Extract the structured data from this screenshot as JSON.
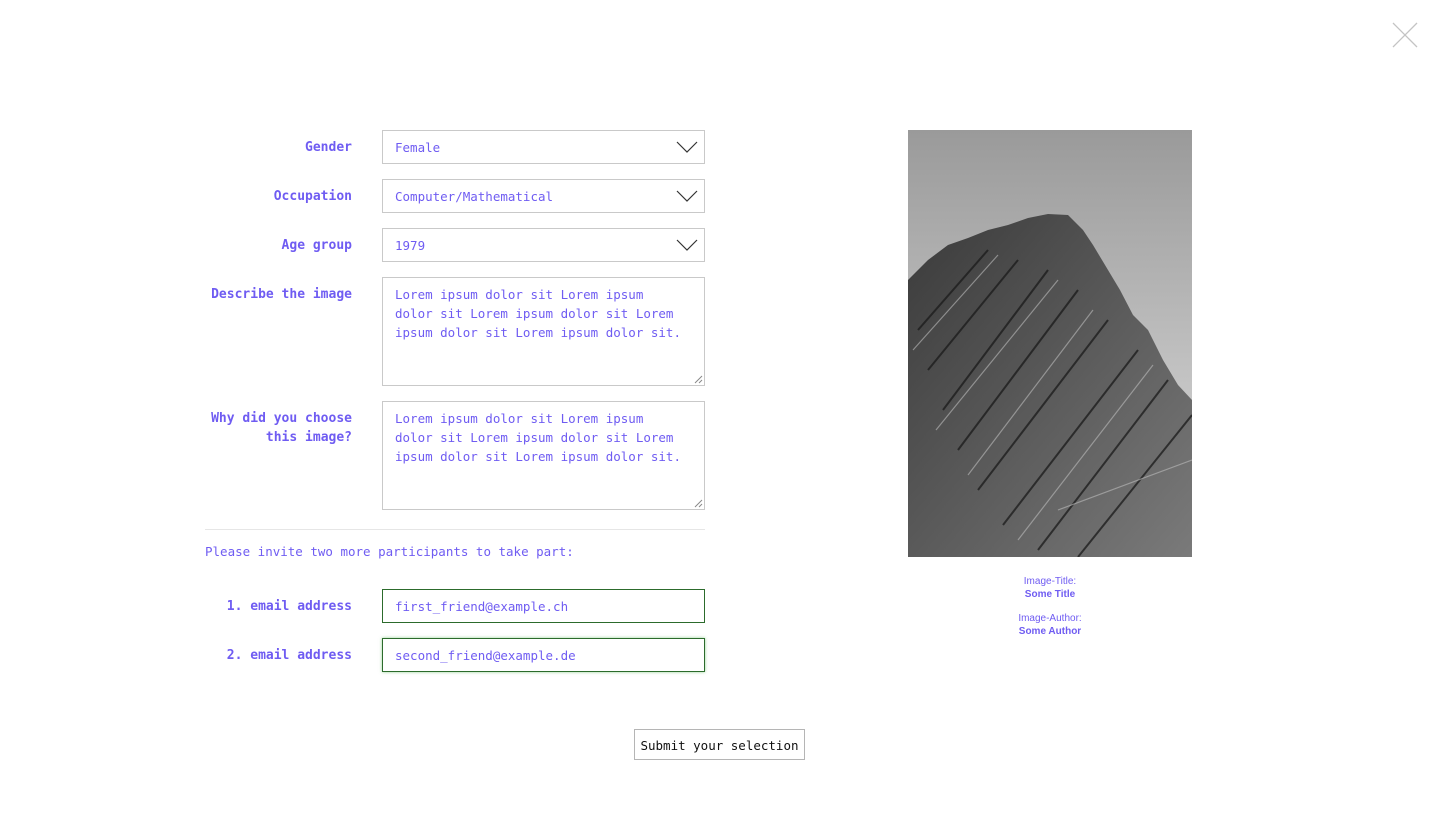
{
  "form": {
    "gender": {
      "label": "Gender",
      "value": "Female"
    },
    "occupation": {
      "label": "Occupation",
      "value": "Computer/Mathematical"
    },
    "age_group": {
      "label": "Age group",
      "value": "1979"
    },
    "describe": {
      "label": "Describe the image",
      "value": "Lorem ipsum dolor sit Lorem ipsum dolor sit Lorem ipsum dolor sit Lorem ipsum dolor sit Lorem ipsum dolor sit."
    },
    "why": {
      "label_line1": "Why did you choose",
      "label_line2": "this image?",
      "value": "Lorem ipsum dolor sit Lorem ipsum dolor sit Lorem ipsum dolor sit Lorem ipsum dolor sit Lorem ipsum dolor sit."
    }
  },
  "invite": {
    "text": "Please invite two more participants to take part:",
    "email1": {
      "label": "1. email address",
      "value": "first_friend@example.ch"
    },
    "email2": {
      "label": "2. email address",
      "value": "second_friend@example.de"
    }
  },
  "submit_label": "Submit your selection",
  "image": {
    "title_label": "Image-Title:",
    "title": "Some Title",
    "author_label": "Image-Author:",
    "author": "Some Author"
  },
  "icons": {
    "close": "close-icon",
    "dropdown": "chevron-down-icon",
    "resize": "resize-grip-icon"
  },
  "colors": {
    "accent": "#6f5cf2",
    "email_border": "#2c6b2c",
    "input_border": "#c9c9c9"
  }
}
